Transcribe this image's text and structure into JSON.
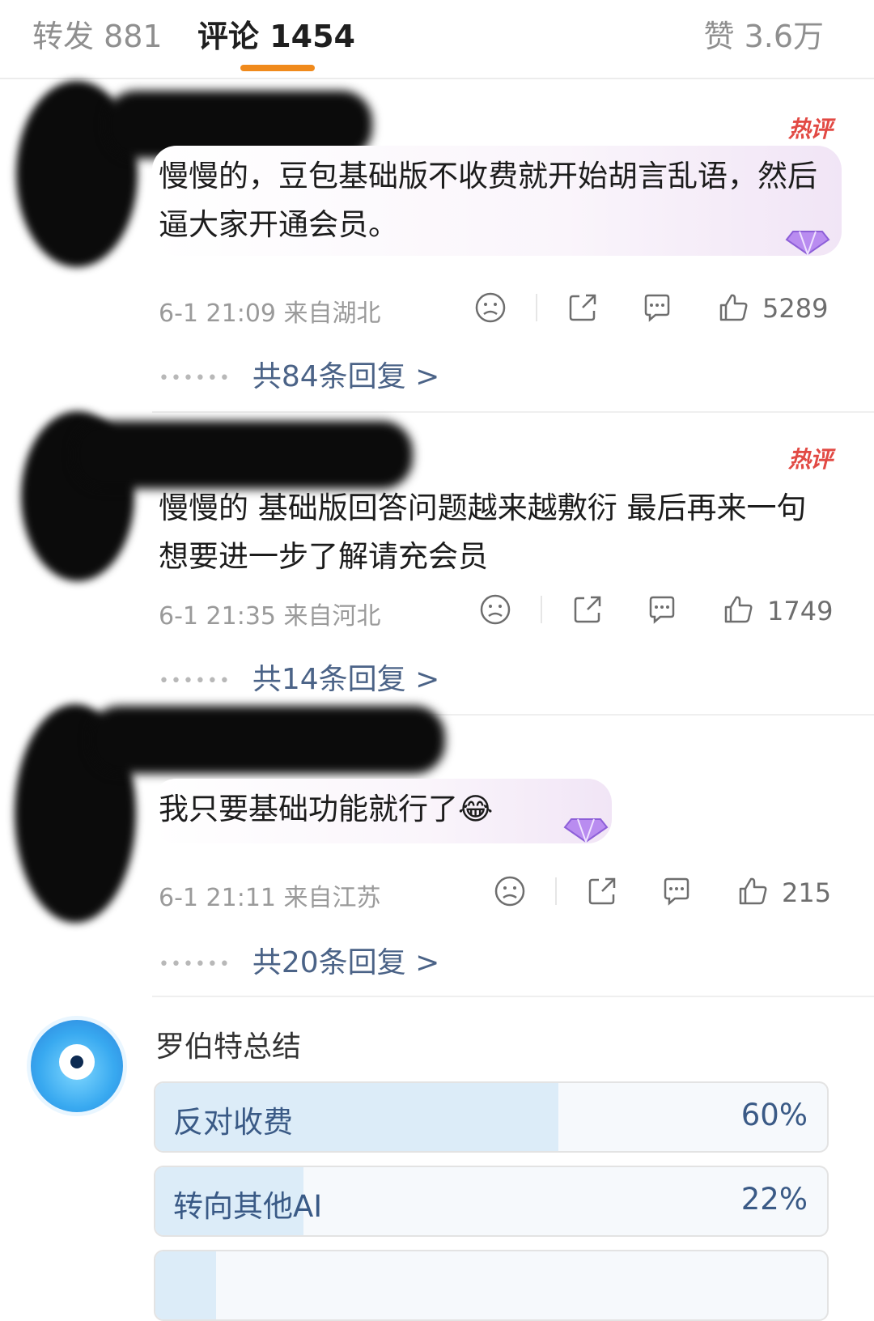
{
  "tabs": {
    "repost": "转发 881",
    "comments": "评论 1454",
    "likes": "赞 3.6万"
  },
  "comments": [
    {
      "badge": "热评",
      "text": "慢慢的，豆包基础版不收费就开始胡言乱语，然后逼大家开通会员。",
      "time_location": "6-1 21:09 来自湖北",
      "likes": "5289",
      "replies": "共84条回复 >"
    },
    {
      "badge": "热评",
      "text": "慢慢的 基础版回答问题越来越敷衍 最后再来一句 想要进一步了解请充会员",
      "time_location": "6-1 21:35 来自河北",
      "likes": "1749",
      "replies": "共14条回复 >"
    },
    {
      "text": "我只要基础功能就行了😂",
      "time_location": "6-1 21:11 来自江苏",
      "likes": "215",
      "replies": "共20条回复 >"
    }
  ],
  "summary": {
    "title": "罗伯特总结",
    "options": [
      {
        "label": "反对收费",
        "percent": "60%",
        "fraction": 0.6
      },
      {
        "label": "转向其他AI",
        "percent": "22%",
        "fraction": 0.22
      }
    ]
  },
  "icons": [
    "sad-face-icon",
    "share-icon",
    "comment-icon",
    "thumbs-up-icon",
    "gem-icon",
    "robot-avatar-icon"
  ],
  "colors": {
    "accent": "#f08a1c",
    "hot": "#e24a44",
    "link": "#4b6387",
    "poll_fill": "#dcecf8"
  }
}
